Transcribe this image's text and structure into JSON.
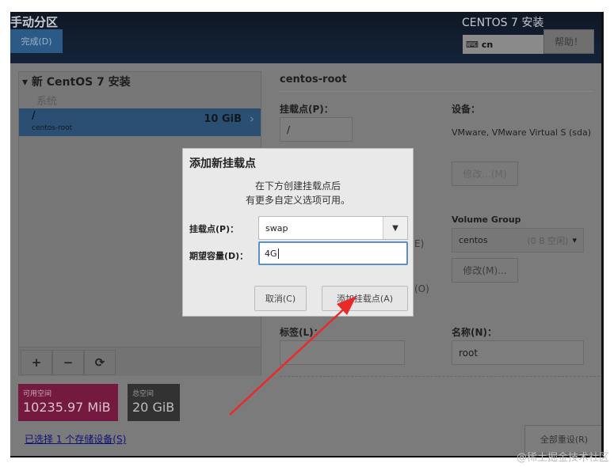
{
  "header": {
    "title": "手动分区",
    "done_button": "完成(D)",
    "product": "CENTOS 7 安装",
    "keyboard_layout": "cn",
    "help_button": "帮助！"
  },
  "left": {
    "group": "新 CentOS 7 安装",
    "section": "系统",
    "selected": {
      "mount": "/",
      "name": "centos-root",
      "size": "10 GiB"
    },
    "tools": {
      "add": "+",
      "remove": "−",
      "refresh": "⟳"
    }
  },
  "space": {
    "available_label": "可用空间",
    "available_value": "10235.97 MiB",
    "total_label": "总空间",
    "total_value": "20 GiB"
  },
  "storage_link": "已选择 1 个存储设备(S)",
  "reset_button": "全部重设(R)",
  "detail": {
    "title": "centos-root",
    "mount_label": "挂载点(P)：",
    "mount_value": "/",
    "device_label": "设备：",
    "device_value": "VMware, VMware Virtual S (sda)",
    "modify_button": "修改...(M)",
    "vg_label": "Volume Group",
    "vg_name": "centos",
    "vg_free": "(0 B 空闲)",
    "vg_modify_button": "修改(M)...",
    "frag_e": "E)",
    "frag_o": "(O)",
    "tag_label": "标签(L)：",
    "tag_value": "",
    "name_label": "名称(N)：",
    "name_value": "root"
  },
  "dialog": {
    "title": "添加新挂载点",
    "desc1": "在下方创建挂载点后",
    "desc2": "有更多自定义选项可用。",
    "mount_label": "挂载点(P)：",
    "mount_value": "swap",
    "capacity_label": "期望容量(D)：",
    "capacity_value": "4G",
    "cancel": "取消(C)",
    "add": "添加挂载点(A)"
  },
  "watermark": "@稀土掘金技术社区"
}
